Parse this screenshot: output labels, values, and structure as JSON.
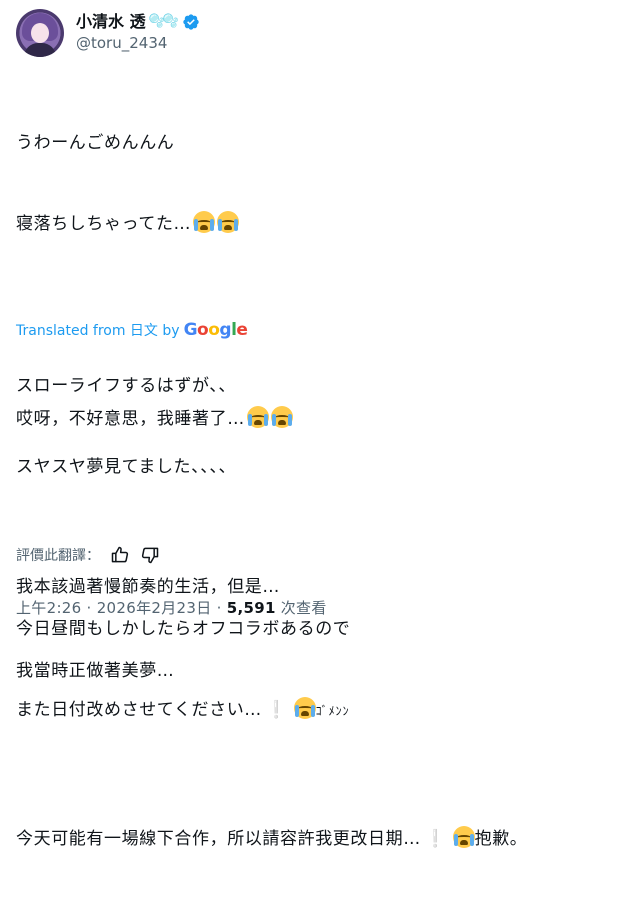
{
  "user": {
    "display_name": "小清水 透",
    "name_emoji": "🫧🫧",
    "handle": "@toru_2434"
  },
  "tweet": {
    "line1": "うわーんごめんんん",
    "line2": "寝落ちしちゃってた…",
    "line3": "スローライフするはずが、、",
    "line4": "スヤスヤ夢見てました、、、、",
    "line5": "今日昼間もしかしたらオフコラボあるので",
    "line6": "また日付改めさせてください…",
    "line6_tail": "ｺﾞﾒﾝﾝ"
  },
  "translation": {
    "label": "Translated from 日文 by",
    "google": [
      "G",
      "o",
      "o",
      "g",
      "l",
      "e"
    ],
    "line1": "哎呀，不好意思，我睡著了…",
    "line2": "我本該過著慢節奏的生活，但是…",
    "line3": "我當時正做著美夢…",
    "line4": "今天可能有一場線下合作，所以請容許我更改日期…",
    "line4_tail": "抱歉。"
  },
  "rate": {
    "label": "評價此翻譯："
  },
  "meta": {
    "time": "上午2:26",
    "separator": " · ",
    "date": "2026年2月23日",
    "views_count": "5,591",
    "views_label": " 次查看"
  },
  "colors": {
    "accent": "#1d9bf0",
    "muted": "#536471",
    "text": "#0f1419"
  },
  "icons": [
    "verified-badge-icon",
    "loudly-crying-face-icon",
    "exclamation-icon",
    "thumbs-up-icon",
    "thumbs-down-icon"
  ]
}
